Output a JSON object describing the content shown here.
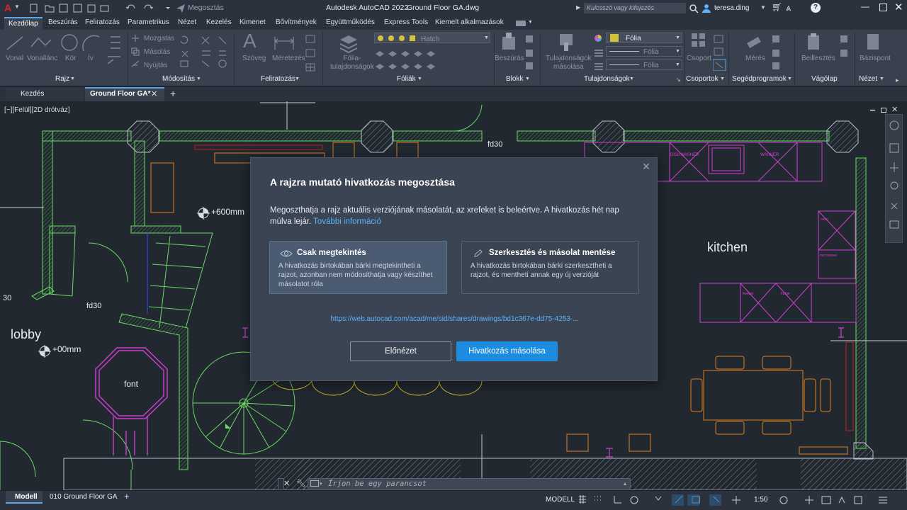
{
  "titlebar": {
    "app_title": "Autodesk AutoCAD 2022",
    "doc_title": "Ground Floor  GA.dwg",
    "share_label": "Megosztás",
    "search_placeholder": "Kulcsszó vagy kifejezés",
    "user": "teresa.ding"
  },
  "ribbon_tabs": [
    "Kezdőlap",
    "Beszúrás",
    "Feliratozás",
    "Parametrikus",
    "Nézet",
    "Kezelés",
    "Kimenet",
    "Bővítmények",
    "Együttműködés",
    "Express Tools",
    "Kiemelt alkalmazások"
  ],
  "ribbon": {
    "draw_tools": [
      "Vonal",
      "Vonallánc",
      "Kör",
      "Ív"
    ],
    "modify_tools": [
      "Mozgatás",
      "Másolás",
      "Nyújtás"
    ],
    "annot_tools": [
      "Szöveg",
      "Méretezés"
    ],
    "layer_props": "Fólia-\ntulajdonságok",
    "layer_current": "Hatch",
    "block_insert": "Beszúrás",
    "match_props": "Tulajdonságok\nmásolása",
    "layer_dropdown": "Fólia",
    "linetype_1": "Fólia",
    "linetype_2": "Fólia",
    "group": "Csoport",
    "measure": "Mérés",
    "paste": "Beillesztés",
    "base": "Bázispont",
    "panels": [
      "Rajz",
      "Módosítás",
      "Feliratozás",
      "Fóliák",
      "Blokk",
      "Tulajdonságok",
      "Csoportok",
      "Segédprogramok",
      "Vágólap",
      "Nézet"
    ]
  },
  "doctabs": {
    "start": "Kezdés",
    "current": "Ground Floor  GA*"
  },
  "canvas": {
    "viewport_label": "[−][Felül][2D drótváz]",
    "labels": {
      "fd30_top": "fd30",
      "fd30_left": "fd30",
      "elev_600": "+600mm",
      "elev_00": "+00mm",
      "lobby": "lobby",
      "font": "font",
      "kitchen": "kitchen",
      "num_30": "30",
      "dishwasher": "DISHWASHER",
      "washer": "WASHER",
      "oven": "oven",
      "microwave": "microwave",
      "freezer": "freezer",
      "fridge": "fridge"
    }
  },
  "dialog": {
    "title": "A rajzra mutató hivatkozás megosztása",
    "body": "Megoszthatja a rajz aktuális verziójának másolatát, az xrefeket is beleértve. A hivatkozás hét nap múlva lejár.",
    "more_info": "További információ",
    "option_view": {
      "title": "Csak megtekintés",
      "desc": "A hivatkozás birtokában bárki megtekintheti a rajzot, azonban nem módosíthatja vagy készíthet másolatot róla"
    },
    "option_edit": {
      "title": "Szerkesztés és másolat mentése",
      "desc": "A hivatkozás birtokában bárki szerkesztheti a rajzot, és mentheti annak egy új verzióját"
    },
    "url": "https://web.autocad.com/acad/me/sid/shares/drawings/bd1c367e-dd75-4253-...",
    "preview_button": "Előnézet",
    "copy_button": "Hivatkozás másolása"
  },
  "command": {
    "placeholder": "Írjon be egy parancsot"
  },
  "statusbar": {
    "tab_model": "Modell",
    "tab_layout": "010 Ground Floor GA",
    "model_label": "MODELL",
    "scale": "1:50"
  },
  "colors": {
    "accent": "#1c8ce0",
    "wall": "#6ad864",
    "magenta": "#d040d0",
    "orange": "#e08020"
  }
}
